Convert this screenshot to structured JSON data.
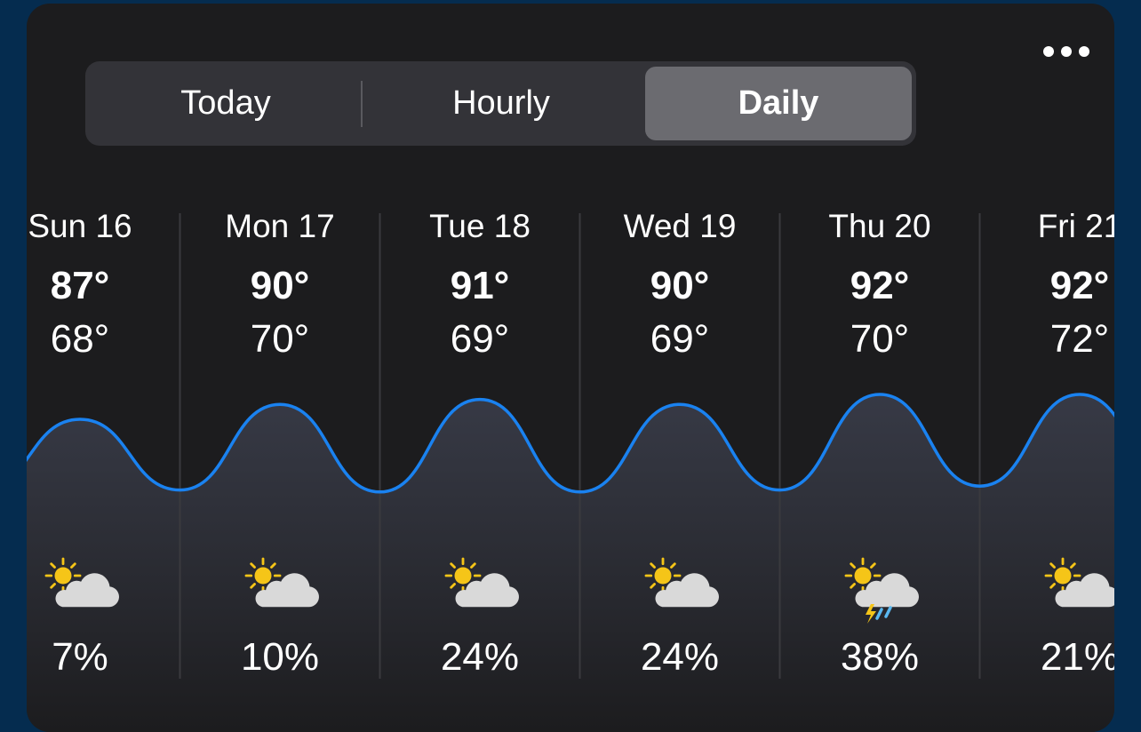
{
  "tabs": [
    {
      "label": "Today",
      "selected": false
    },
    {
      "label": "Hourly",
      "selected": false
    },
    {
      "label": "Daily",
      "selected": true
    }
  ],
  "more_icon": "ellipsis-icon",
  "colors": {
    "background": "#052c4f",
    "card": "#1c1c1e",
    "segment_bg": "#333338",
    "segment_selected": "#6b6b70",
    "curve": "#1a82f0",
    "sun": "#f5c518",
    "cloud": "#d9d9d9"
  },
  "days": [
    {
      "label": "Sun 16",
      "high": "87°",
      "low": "68°",
      "precip": "7%",
      "icon": "partly-cloudy-icon"
    },
    {
      "label": "Mon 17",
      "high": "90°",
      "low": "70°",
      "precip": "10%",
      "icon": "partly-cloudy-icon"
    },
    {
      "label": "Tue 18",
      "high": "91°",
      "low": "69°",
      "precip": "24%",
      "icon": "partly-cloudy-icon"
    },
    {
      "label": "Wed 19",
      "high": "90°",
      "low": "69°",
      "precip": "24%",
      "icon": "partly-cloudy-icon"
    },
    {
      "label": "Thu 20",
      "high": "92°",
      "low": "70°",
      "precip": "38%",
      "icon": "thunderstorm-icon"
    },
    {
      "label": "Fri 21",
      "high": "92°",
      "low": "72°",
      "precip": "21%",
      "icon": "partly-cloudy-icon"
    }
  ],
  "chart_data": {
    "type": "line",
    "categories": [
      "Sun 16",
      "Mon 17",
      "Tue 18",
      "Wed 19",
      "Thu 20",
      "Fri 21"
    ],
    "series": [
      {
        "values": [
          87,
          90,
          91,
          90,
          92,
          92
        ]
      },
      {
        "values": [
          68,
          70,
          69,
          69,
          70,
          72
        ]
      }
    ],
    "precipitation_percent": [
      7,
      10,
      24,
      24,
      38,
      21
    ]
  }
}
